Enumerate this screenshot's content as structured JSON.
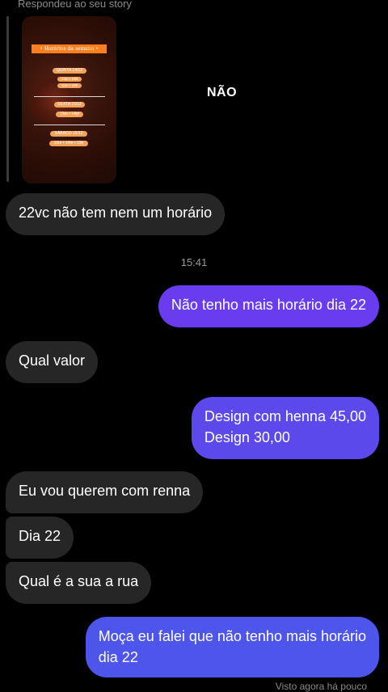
{
  "story": {
    "reply_label": "Respondeu ao seu story",
    "header": "• Horários da semana •",
    "days": [
      {
        "label": "QUINTA 14/12",
        "times": [
          "14m • 19h",
          "1pm • 19h"
        ]
      },
      {
        "label": "SEXTA 15/12",
        "times": [
          "15m • 14pt"
        ]
      },
      {
        "label": "SÁBADO 16/12",
        "times": [
          "10m • 14m • 19h"
        ]
      }
    ]
  },
  "overlay_text": "NÃO",
  "messages": [
    {
      "id": "m1",
      "text": "22vc não tem nem um horário"
    },
    {
      "id": "m2",
      "text": "Não tenho mais horário dia 22"
    },
    {
      "id": "m3",
      "text": "Qual valor"
    },
    {
      "id": "m4a",
      "text": "Design com henna 45,00"
    },
    {
      "id": "m4b",
      "text": "Design 30,00"
    },
    {
      "id": "m5",
      "text": "Eu vou querem com renna"
    },
    {
      "id": "m6",
      "text": "Dia 22"
    },
    {
      "id": "m7",
      "text": "Qual é a sua a rua"
    },
    {
      "id": "m8a",
      "text": "Moça eu falei que não tenho mais horário"
    },
    {
      "id": "m8b",
      "text": "dia 22"
    }
  ],
  "timestamp": "15:41",
  "seen_status": "Visto agora há pouco",
  "colors": {
    "incoming_bubble": "#262626",
    "outgoing_bubble_1": "#6a3cf0",
    "outgoing_bubble_2": "#5b49ec",
    "outgoing_bubble_3": "#4d55eb",
    "story_accent": "#ff7f1e"
  }
}
